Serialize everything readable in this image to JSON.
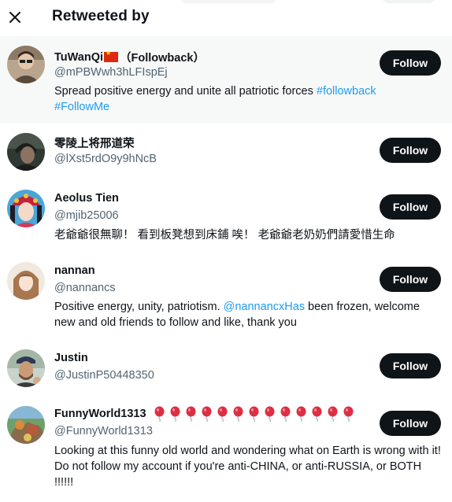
{
  "header": {
    "title": "Retweeted by",
    "close_icon": "close-icon"
  },
  "colors": {
    "link": "#1d9bf0",
    "button": "#0f1419",
    "handle": "#536471",
    "highlight": "#f7f9f9"
  },
  "follow_label": "Follow",
  "users": [
    {
      "name_part1": "TuWanQi",
      "flag_icon": "china-flag-icon",
      "name_part2": "（Followback）",
      "handle": "@mPBWwh3hLFIspEj",
      "bio_text": "Spread positive energy and unite all patriotic forces ",
      "bio_link1": "#followback",
      "bio_link2": "#FollowMe"
    },
    {
      "name": "零陵上将邢道荣",
      "handle": "@lXst5rdO9y9hNcB"
    },
    {
      "name": "Aeolus Tien",
      "handle": "@mjib25006",
      "bio_text": "老爺爺很無聊！ 看到板凳想到床鋪 唉！ 老爺爺老奶奶們請愛惜生命"
    },
    {
      "name": "nannan",
      "handle": "@nannancs",
      "bio_text1": "Positive energy, unity, patriotism. ",
      "bio_link": "@nannancxHas",
      "bio_text2": " been frozen, welcome new and old friends to follow and like, thank you"
    },
    {
      "name": "Justin",
      "handle": "@JustinP50448350"
    },
    {
      "name": "FunnyWorld1313",
      "name_icons": "balloon-icon",
      "balloon_count": 13,
      "handle": "@FunnyWorld1313",
      "bio_text": "Looking at this funny old world and wondering what on Earth is wrong with it! Do not follow my account if you're anti-CHINA, or anti-RUSSIA, or BOTH !!!!!!"
    }
  ]
}
